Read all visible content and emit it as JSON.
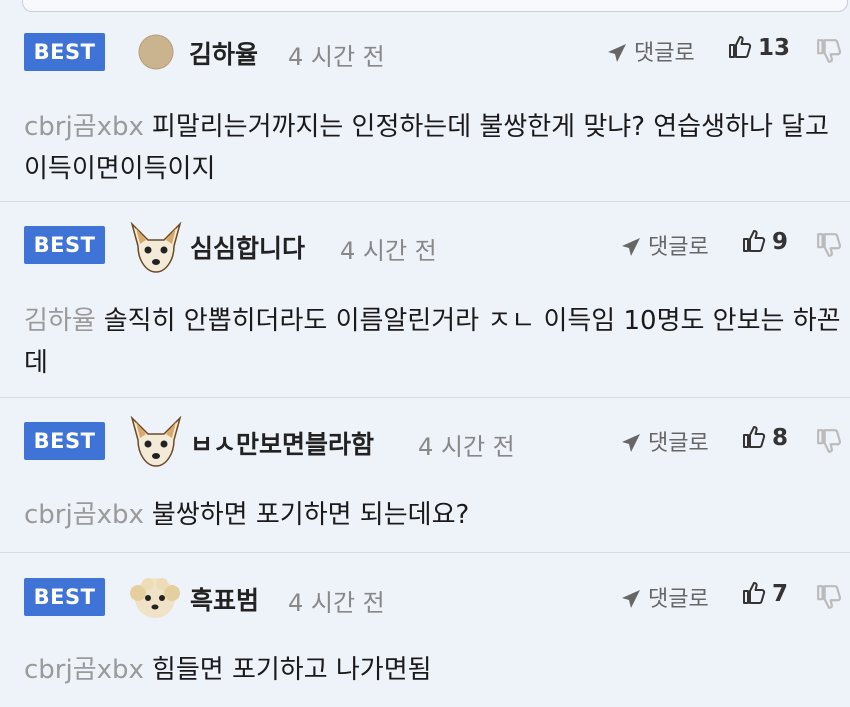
{
  "comments": [
    {
      "badge": "BEST",
      "author": "김하율",
      "avatar": "beige-dot-avatar",
      "time": "4 시간 전",
      "reply_label": "댓글로",
      "likes": "13",
      "mention": "cbrj곰xbx",
      "text": "피말리는거까지는 인정하는데 불쌍한게 맞냐? 연습생하나 달고 이득이면이득이지"
    },
    {
      "badge": "BEST",
      "author": "심심합니다",
      "avatar": "chihuahua-avatar",
      "time": "4 시간 전",
      "reply_label": "댓글로",
      "likes": "9",
      "mention": "김하율",
      "text": "솔직히 안뽑히더라도 이름알린거라 ㅈㄴ 이득임 10명도 안보는 하꼰데"
    },
    {
      "badge": "BEST",
      "author": "ㅂㅅ만보면블라함",
      "avatar": "chihuahua-avatar",
      "time": "4 시간 전",
      "reply_label": "댓글로",
      "likes": "8",
      "mention": "cbrj곰xbx",
      "text": "불쌍하면 포기하면 되는데요?"
    },
    {
      "badge": "BEST",
      "author": "흑표범",
      "avatar": "poodle-avatar",
      "time": "4 시간 전",
      "reply_label": "댓글로",
      "likes": "7",
      "mention": "cbrj곰xbx",
      "text": "힘들면 포기하고 나가면됨"
    }
  ],
  "colors": {
    "background": "#eef2f9",
    "badge": "#3f74d6",
    "mention": "#9a9a9a",
    "divider": "#d6dae3"
  },
  "icons": {
    "reply": "reply-arrow-icon",
    "like": "thumbs-up-icon",
    "dislike": "thumbs-down-icon"
  }
}
